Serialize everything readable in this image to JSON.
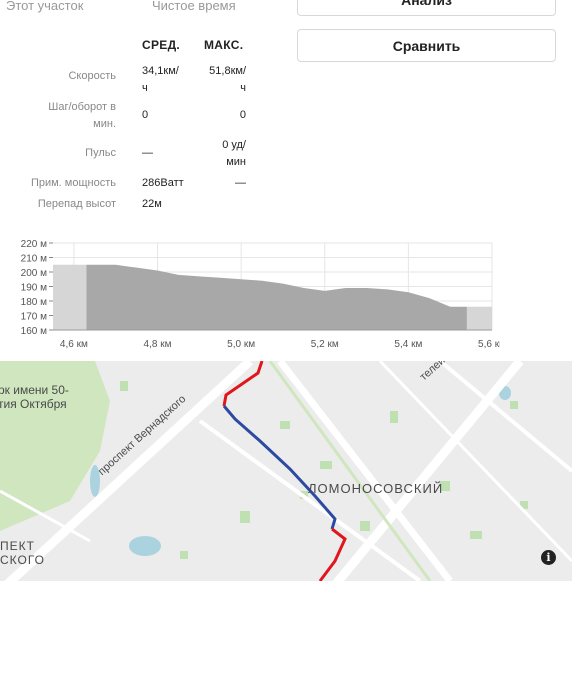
{
  "segment": {
    "this_segment_label": "Этот участок",
    "net_time_label": "Чистое время"
  },
  "buttons": {
    "analysis_label": "Анализ",
    "compare_label": "Сравнить"
  },
  "stats": {
    "col_avg": "СРЕД.",
    "col_max": "МАКС.",
    "rows": [
      {
        "label": "Скорость",
        "avg": "34,1км/\nч",
        "max": "51,8км/\nч"
      },
      {
        "label": "Шаг/оборот в\nмин.",
        "avg": "0",
        "max": "0"
      },
      {
        "label": "Пульс",
        "avg": "—",
        "max": "0 уд/\nмин"
      },
      {
        "label": "Прим. мощность",
        "avg": "286Ватт",
        "max": "—"
      },
      {
        "label": "Перепад высот",
        "avg": "22м",
        "max": ""
      }
    ]
  },
  "chart_data": {
    "type": "area",
    "x_unit": "км",
    "y_unit": "м",
    "y_ticks": [
      "160 м",
      "170 м",
      "180 м",
      "190 м",
      "200 м",
      "210 м",
      "220 м"
    ],
    "x_ticks": [
      "4,6 км",
      "4,8 км",
      "5,0 км",
      "5,2 км",
      "5,4 км",
      "5,6 км"
    ],
    "ylim": [
      160,
      220
    ],
    "xlim": [
      4.55,
      5.6
    ],
    "segment_range": [
      4.63,
      5.54
    ],
    "x": [
      4.55,
      4.63,
      4.66,
      4.7,
      4.75,
      4.8,
      4.85,
      4.9,
      4.95,
      5.0,
      5.05,
      5.1,
      5.15,
      5.2,
      5.25,
      5.3,
      5.35,
      5.4,
      5.45,
      5.5,
      5.54,
      5.6
    ],
    "y": [
      205,
      205,
      205,
      205,
      203,
      201,
      198,
      197,
      196,
      195,
      194,
      192,
      189,
      187,
      189,
      189,
      188,
      186,
      182,
      176,
      176,
      176
    ],
    "colors": {
      "segment_fill": "#a8a8a8",
      "outside_fill": "#d6d6d6",
      "grid": "#e6e6e6"
    }
  },
  "map": {
    "labels": {
      "park": "рк имени 50-\nтия Октября",
      "avenue": "проспект Вернадского",
      "district": "ЛОМОНОСОВСКИЙ",
      "district2": "ПЕКТ\nСКОГО",
      "street": "телей"
    },
    "info_icon": "info-icon",
    "colors": {
      "route": "#e0161c",
      "segment": "#2b4aa0",
      "park": "#cfe6bf",
      "road": "#ffffff",
      "base": "#ececec"
    }
  }
}
